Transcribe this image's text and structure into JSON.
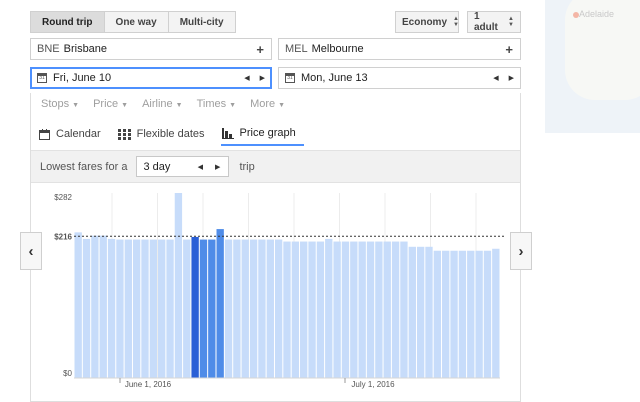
{
  "trip_type": {
    "options": [
      "Round trip",
      "One way",
      "Multi-city"
    ],
    "selected": "Round trip"
  },
  "cabin": "Economy",
  "passengers": "1 adult",
  "origin": {
    "code": "BNE",
    "city": "Brisbane"
  },
  "destination": {
    "code": "MEL",
    "city": "Melbourne"
  },
  "depart_date": "Fri, June 10",
  "return_date": "Mon, June 13",
  "filters": [
    "Stops",
    "Price",
    "Airline",
    "Times",
    "More"
  ],
  "views": [
    {
      "label": "Calendar",
      "icon": "calendar-icon"
    },
    {
      "label": "Flexible dates",
      "icon": "grid-icon"
    },
    {
      "label": "Price graph",
      "icon": "bar-chart-icon",
      "active": true
    }
  ],
  "lowest_fares": {
    "prefix": "Lowest fares for a",
    "trip_length": "3 day",
    "suffix": "trip"
  },
  "map": {
    "city_label": "Adelaide"
  },
  "chart_data": {
    "type": "bar",
    "title": "",
    "y_tick_labels": [
      "$282",
      "$216",
      "$0"
    ],
    "reference_line": {
      "label": "$216",
      "value": 216
    },
    "x_tick_labels": [
      "June 1, 2016",
      "July 1, 2016"
    ],
    "ylim": [
      0,
      282
    ],
    "values": [
      222,
      212,
      217,
      217,
      212,
      211,
      211,
      211,
      211,
      211,
      211,
      211,
      282,
      211,
      215,
      211,
      211,
      227,
      211,
      211,
      211,
      211,
      211,
      211,
      211,
      208,
      208,
      208,
      208,
      208,
      212,
      208,
      208,
      208,
      208,
      208,
      208,
      208,
      208,
      208,
      200,
      200,
      200,
      194,
      194,
      194,
      194,
      194,
      194,
      194,
      197
    ],
    "selected_index": 14,
    "highlight_indices": [
      15,
      16,
      17
    ],
    "colors": {
      "bar": "#c7dcfa",
      "selected": "#2a5fd6",
      "highlight": "#4f8ce8",
      "reference": "#333333"
    }
  }
}
